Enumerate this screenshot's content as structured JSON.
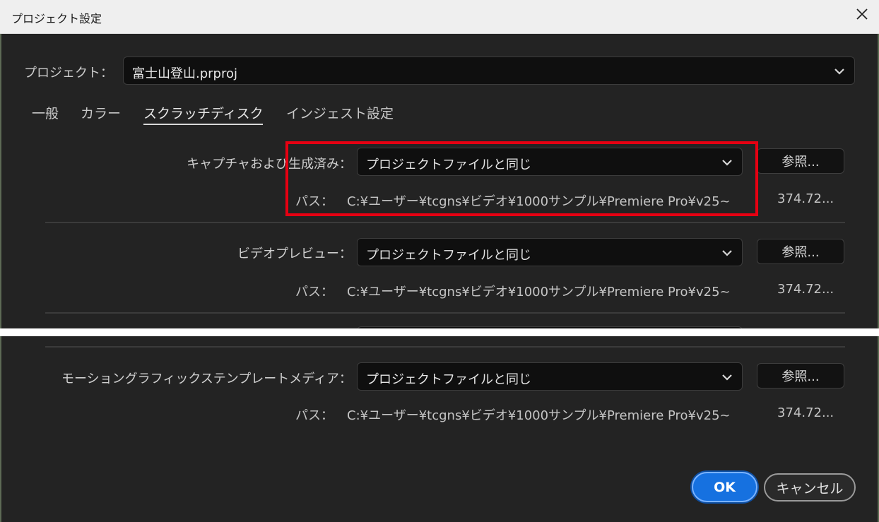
{
  "window": {
    "title": "プロジェクト設定"
  },
  "project": {
    "label": "プロジェクト：",
    "value": "富士山登山.prproj"
  },
  "tabs": [
    {
      "label": "一般"
    },
    {
      "label": "カラー"
    },
    {
      "label": "スクラッチディスク",
      "active": true
    },
    {
      "label": "インジェスト設定"
    }
  ],
  "scratch": [
    {
      "label": "キャプチャおよび生成済み：",
      "select": "プロジェクトファイルと同じ",
      "browse": "参照...",
      "path_label": "パス：",
      "path": "C:¥ユーザー¥tcgns¥ビデオ¥1000サンプル¥Premiere Pro¥v25~",
      "size": "374.72..."
    },
    {
      "label": "ビデオプレビュー：",
      "select": "プロジェクトファイルと同じ",
      "browse": "参照...",
      "path_label": "パス：",
      "path": "C:¥ユーザー¥tcgns¥ビデオ¥1000サンプル¥Premiere Pro¥v25~",
      "size": "374.72..."
    },
    {
      "label": "モーショングラフィックステンプレートメディア：",
      "select": "プロジェクトファイルと同じ",
      "browse": "参照...",
      "path_label": "パス：",
      "path": "C:¥ユーザー¥tcgns¥ビデオ¥1000サンプル¥Premiere Pro¥v25~",
      "size": "374.72..."
    }
  ],
  "buttons": {
    "ok": "OK",
    "cancel": "キャンセル"
  },
  "colors": {
    "highlight": "#e60012",
    "accent": "#1671e0",
    "panel": "#232323"
  }
}
